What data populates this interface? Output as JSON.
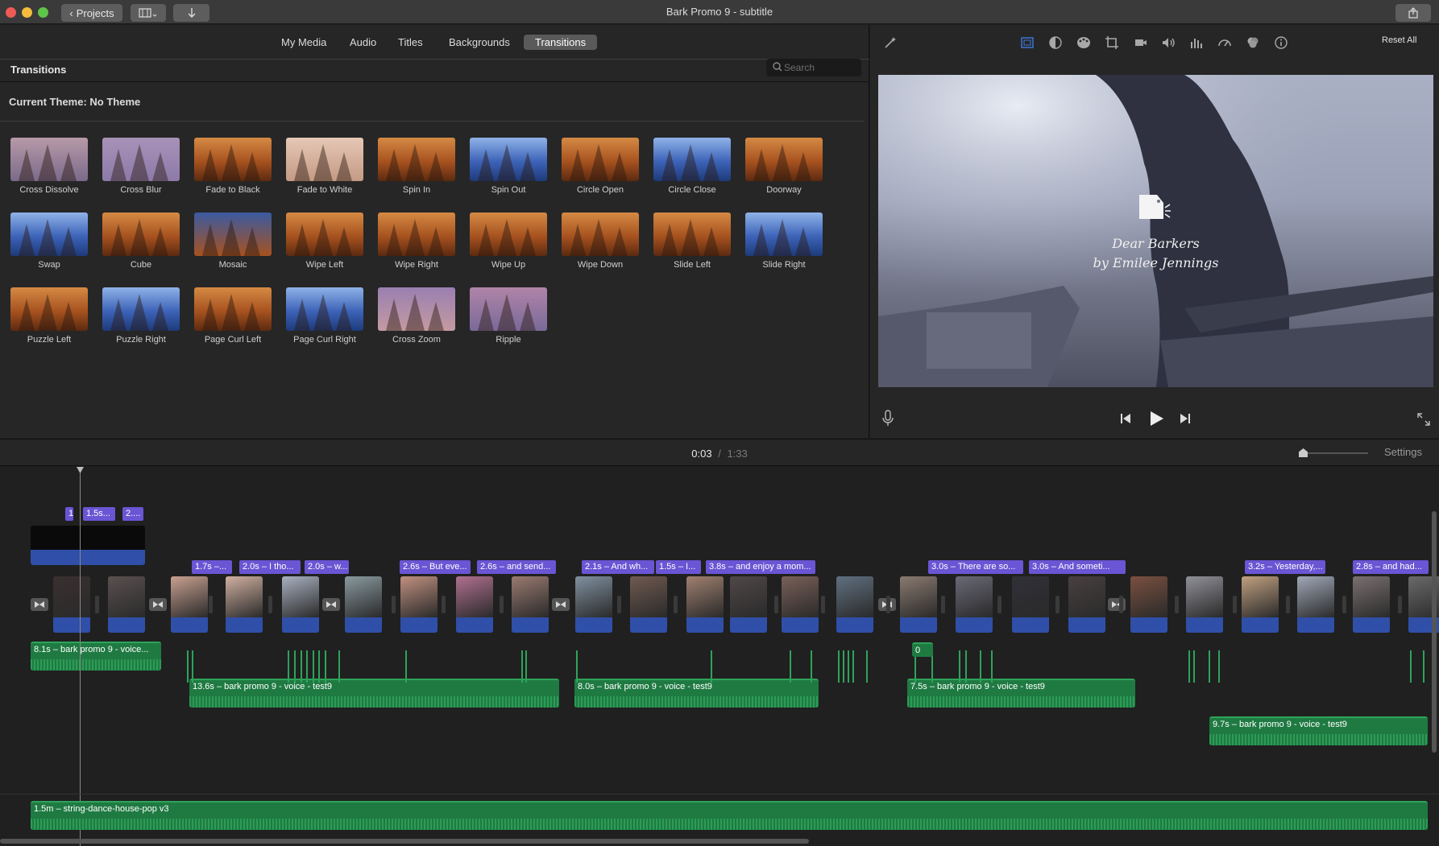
{
  "window": {
    "title": "Bark Promo 9 - subtitle",
    "projects_label": "Projects"
  },
  "browser": {
    "tabs": [
      {
        "label": "My Media"
      },
      {
        "label": "Audio"
      },
      {
        "label": "Titles"
      },
      {
        "label": "Backgrounds"
      },
      {
        "label": "Transitions",
        "active": true
      }
    ],
    "title": "Transitions",
    "search_placeholder": "Search",
    "theme_label": "Current Theme: No Theme",
    "transitions": [
      {
        "label": "Cross Dissolve"
      },
      {
        "label": "Cross Blur"
      },
      {
        "label": "Fade to Black"
      },
      {
        "label": "Fade to White"
      },
      {
        "label": "Spin In"
      },
      {
        "label": "Spin Out"
      },
      {
        "label": "Circle Open"
      },
      {
        "label": "Circle Close"
      },
      {
        "label": "Doorway"
      },
      {
        "label": "Swap"
      },
      {
        "label": "Cube"
      },
      {
        "label": "Mosaic"
      },
      {
        "label": "Wipe Left"
      },
      {
        "label": "Wipe Right"
      },
      {
        "label": "Wipe Up"
      },
      {
        "label": "Wipe Down"
      },
      {
        "label": "Slide Left"
      },
      {
        "label": "Slide Right"
      },
      {
        "label": "Puzzle Left"
      },
      {
        "label": "Puzzle Right"
      },
      {
        "label": "Page Curl Left"
      },
      {
        "label": "Page Curl Right"
      },
      {
        "label": "Cross Zoom"
      },
      {
        "label": "Ripple"
      }
    ]
  },
  "viewer": {
    "reset_label": "Reset All",
    "preview_title_line1": "Dear Barkers",
    "preview_title_line2": "by Emilee Jennings"
  },
  "timeline": {
    "current_time": "0:03",
    "separator": "/",
    "total_time": "1:33",
    "settings_label": "Settings",
    "captions": [
      "1...",
      "1.5s...",
      "2....",
      "1.7s –...",
      "2.0s – I tho...",
      "2.0s – w...",
      "2.6s – But eve...",
      "2.6s – and send...",
      "2.1s – And wh...",
      "1.5s – I...",
      "3.8s – and enjoy a mom...",
      "3.0s – There are so...",
      "3.0s – And someti...",
      "3.2s – Yesterday,...",
      "2.8s – and had..."
    ],
    "audio_clips": [
      "8.1s – bark promo 9 - voice...",
      "13.6s – bark promo 9 - voice - test9",
      "8.0s – bark promo 9 - voice - test9",
      "7.5s – bark promo 9 - voice - test9",
      "9.7s – bark promo 9 - voice - test9"
    ],
    "music_clip": "1.5m – string-dance-house-pop v3",
    "clip_digit": "0"
  },
  "colors": {
    "caption": "#6a55d4",
    "audio": "#1f7a42",
    "video_audio": "#2f4fa8",
    "accent_blue": "#3d7be0"
  }
}
